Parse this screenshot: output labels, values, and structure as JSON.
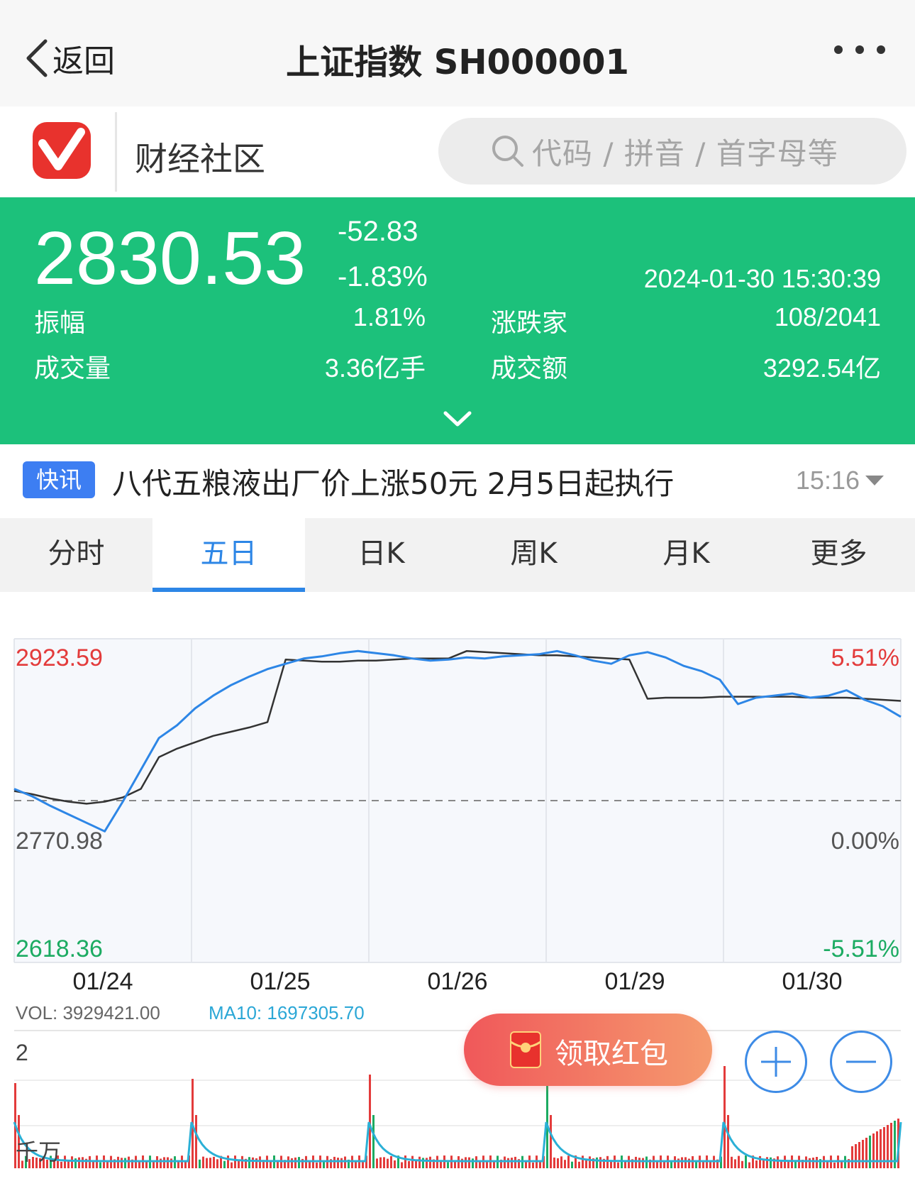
{
  "nav": {
    "back_label": "返回",
    "title": "上证指数 SH000001"
  },
  "brand": {
    "name": "财经社区",
    "search_placeholder": "代码 / 拼音 / 首字母等"
  },
  "quote": {
    "price": "2830.53",
    "change": "-52.83",
    "change_pct": "-1.83%",
    "datetime": "2024-01-30 15:30:39",
    "amplitude_label": "振幅",
    "amplitude": "1.81%",
    "adv_dec_label": "涨跌家",
    "adv_dec": "108/2041",
    "volume_label": "成交量",
    "volume": "3.36亿手",
    "turnover_label": "成交额",
    "turnover": "3292.54亿",
    "color": "#1cc17b"
  },
  "news": {
    "badge": "快讯",
    "headline": "八代五粮液出厂价上涨50元 2月5日起执行",
    "time": "15:16"
  },
  "tabs": [
    "分时",
    "五日",
    "日K",
    "周K",
    "月K",
    "更多"
  ],
  "active_tab": "五日",
  "chart_data": {
    "type": "line",
    "x_labels": [
      "01/24",
      "01/25",
      "01/26",
      "01/29",
      "01/30"
    ],
    "y_left": {
      "max": "2923.59",
      "base": "2770.98",
      "min": "2618.36"
    },
    "y_right": {
      "max": "5.51%",
      "base": "0.00%",
      "min": "-5.51%"
    },
    "ylim": [
      2618.36,
      2923.59
    ],
    "prev_close": 2770.98,
    "series": [
      {
        "color": "#2d86e6",
        "values": [
          2782,
          2775,
          2766,
          2758,
          2750,
          2742,
          2770,
          2800,
          2830,
          2842,
          2858,
          2870,
          2880,
          2888,
          2895,
          2900,
          2905,
          2907,
          2910,
          2912,
          2910,
          2908,
          2905,
          2903,
          2904,
          2906,
          2905,
          2907,
          2908,
          2909,
          2912,
          2908,
          2903,
          2900,
          2908,
          2911,
          2906,
          2898,
          2893,
          2885,
          2862,
          2868,
          2870,
          2872,
          2868,
          2870,
          2875,
          2866,
          2860,
          2850
        ]
      },
      {
        "color": "#333333",
        "values": [
          2780,
          2777,
          2773,
          2770,
          2768,
          2770,
          2774,
          2782,
          2812,
          2820,
          2826,
          2832,
          2836,
          2840,
          2845,
          2904,
          2903,
          2902,
          2902,
          2903,
          2903,
          2904,
          2905,
          2905,
          2905,
          2912,
          2911,
          2910,
          2909,
          2908,
          2908,
          2907,
          2906,
          2905,
          2904,
          2867,
          2868,
          2868,
          2868,
          2869,
          2869,
          2869,
          2869,
          2869,
          2868,
          2868,
          2868,
          2867,
          2866,
          2865
        ]
      }
    ],
    "volume_panel": {
      "vol_label": "VOL: 3929421.00",
      "ma10_label": "MA10: 1697305.70",
      "scale_top": "2",
      "unit": "千万"
    }
  },
  "red_packet_label": "领取红包"
}
